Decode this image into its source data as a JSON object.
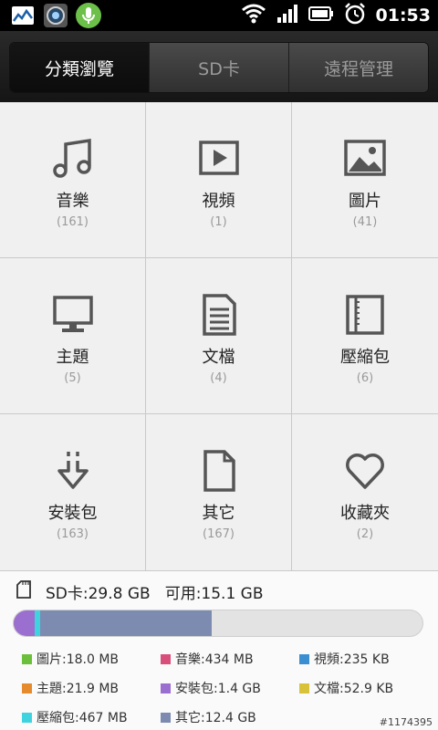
{
  "status_bar": {
    "time": "01:53"
  },
  "tabs": [
    {
      "label": "分類瀏覽",
      "active": true
    },
    {
      "label": "SD卡",
      "active": false
    },
    {
      "label": "遠程管理",
      "active": false
    }
  ],
  "categories": [
    {
      "icon": "music-note-icon",
      "label": "音樂",
      "count": "(161)"
    },
    {
      "icon": "video-play-icon",
      "label": "視頻",
      "count": "(1)"
    },
    {
      "icon": "picture-icon",
      "label": "圖片",
      "count": "(41)"
    },
    {
      "icon": "monitor-icon",
      "label": "主題",
      "count": "(5)"
    },
    {
      "icon": "document-icon",
      "label": "文檔",
      "count": "(4)"
    },
    {
      "icon": "archive-icon",
      "label": "壓縮包",
      "count": "(6)"
    },
    {
      "icon": "install-arrow-icon",
      "label": "安裝包",
      "count": "(163)"
    },
    {
      "icon": "blank-file-icon",
      "label": "其它",
      "count": "(167)"
    },
    {
      "icon": "heart-icon",
      "label": "收藏夾",
      "count": "(2)"
    }
  ],
  "storage": {
    "total": "SD卡:29.8 GB",
    "free": "可用:15.1 GB",
    "used_fractions": {
      "theme": 0.001,
      "install": 0.05,
      "archive": 0.013,
      "other": 0.42
    },
    "legend": [
      {
        "label": "圖片:18.0 MB",
        "color": "#6cbf3a"
      },
      {
        "label": "音樂:434 MB",
        "color": "#d94f7c"
      },
      {
        "label": "視頻:235 KB",
        "color": "#3b8fd1"
      },
      {
        "label": "主題:21.9 MB",
        "color": "#e68a2e"
      },
      {
        "label": "安裝包:1.4 GB",
        "color": "#9b6fd0"
      },
      {
        "label": "文檔:52.9 KB",
        "color": "#d8c23a"
      },
      {
        "label": "壓縮包:467 MB",
        "color": "#3fd3e0"
      },
      {
        "label": "其它:12.4 GB",
        "color": "#7d8bb0"
      }
    ],
    "bar_colors": {
      "theme": "#e68a2e",
      "install": "#9b6fd0",
      "archive": "#3fd3e0",
      "other": "#7d8bb0"
    }
  },
  "watermark": "#1174395"
}
